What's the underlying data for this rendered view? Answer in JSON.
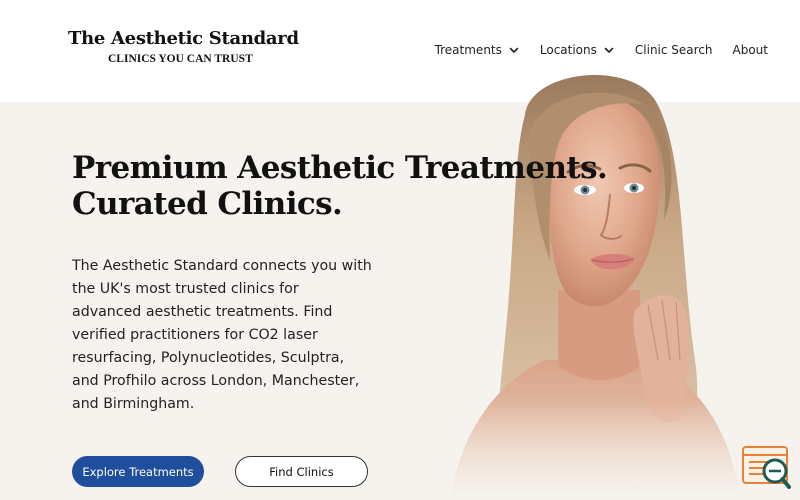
{
  "brand": {
    "title": "The Aesthetic Standard",
    "tagline": "CLINICS YOU CAN TRUST"
  },
  "nav": {
    "items": [
      {
        "label": "Treatments",
        "dropdown": true
      },
      {
        "label": "Locations",
        "dropdown": true
      },
      {
        "label": "Clinic Search",
        "dropdown": false
      },
      {
        "label": "About",
        "dropdown": false
      }
    ]
  },
  "hero": {
    "title_line1": "Premium Aesthetic Treatments.",
    "title_line2": "Curated Clinics.",
    "description": "The Aesthetic Standard connects you with the UK's most trusted clinics for advanced aesthetic treatments. Find verified practitioners for CO2 laser resurfacing, Polynucleotides, Sculptra, and Profhilo across London, Manchester, and Birmingham.",
    "image_icon": "portrait-photo"
  },
  "buttons": {
    "explore": "Explore Treatments",
    "find": "Find Clinics"
  },
  "widget": {
    "icon": "search-widget-icon"
  },
  "colors": {
    "background": "#f6f3ee",
    "header": "#ffffff",
    "primary_button": "#1f4e9d",
    "widget_accent": "#e8823a",
    "widget_ring": "#1d5b56"
  }
}
